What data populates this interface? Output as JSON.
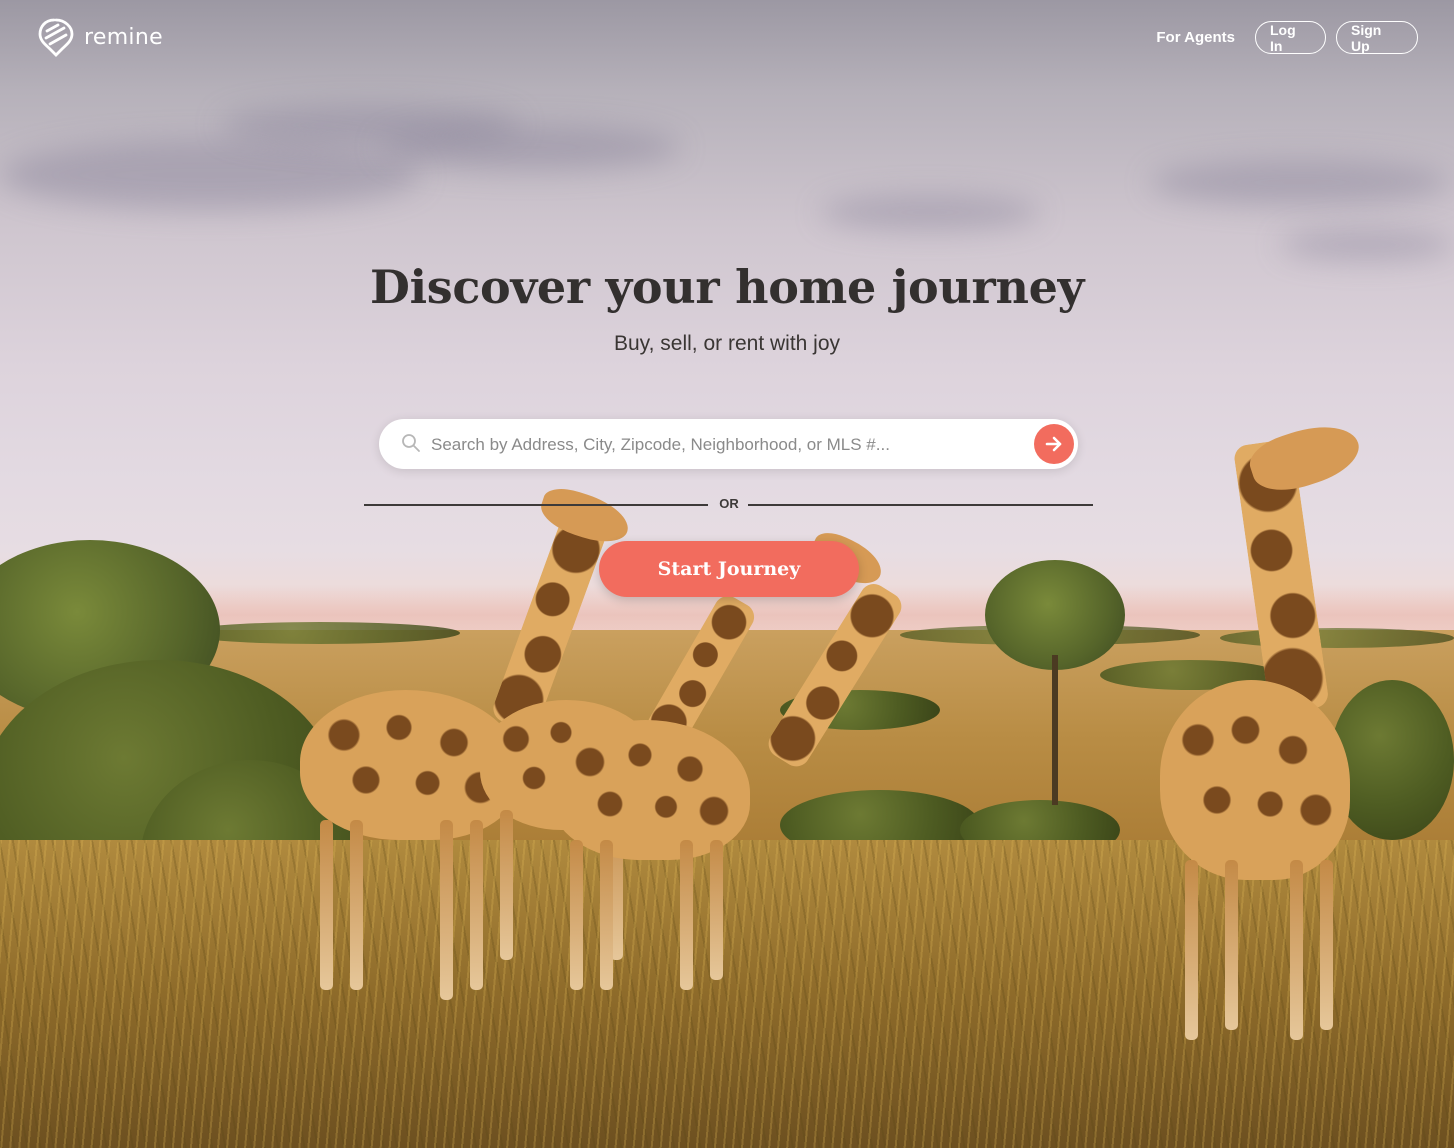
{
  "brand": {
    "name": "remine",
    "accent": "#f26c5e"
  },
  "header": {
    "for_agents": "For Agents",
    "login": "Log In",
    "signup": "Sign Up"
  },
  "hero": {
    "title": "Discover your home journey",
    "subtitle": "Buy, sell, or rent with joy"
  },
  "search": {
    "placeholder": "Search by Address, City, Zipcode, Neighborhood, or MLS #...",
    "value": "",
    "icon": "search-icon",
    "submit_icon": "arrow-right-icon"
  },
  "divider": {
    "text": "OR"
  },
  "cta": {
    "start_label": "Start Journey"
  }
}
